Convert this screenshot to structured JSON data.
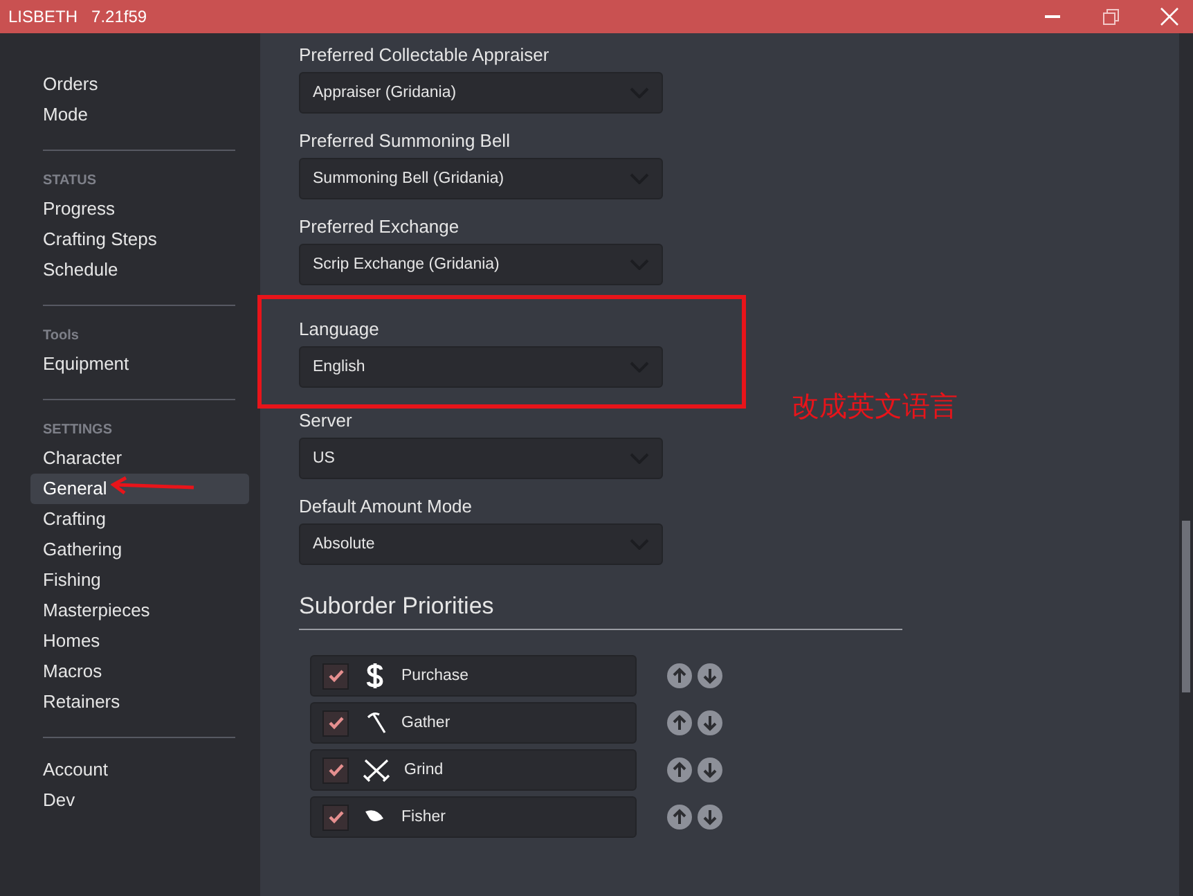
{
  "window": {
    "title": "LISBETH",
    "version": "7.21f59"
  },
  "sidebar": {
    "groups": [
      {
        "items": [
          {
            "label": "Orders",
            "selected": false
          },
          {
            "label": "Mode",
            "selected": false
          }
        ]
      },
      {
        "header": "STATUS",
        "items": [
          {
            "label": "Progress",
            "selected": false
          },
          {
            "label": "Crafting Steps",
            "selected": false
          },
          {
            "label": "Schedule",
            "selected": false
          }
        ]
      },
      {
        "header": "Tools",
        "items": [
          {
            "label": "Equipment",
            "selected": false
          }
        ]
      },
      {
        "header": "SETTINGS",
        "items": [
          {
            "label": "Character",
            "selected": false
          },
          {
            "label": "General",
            "selected": true
          },
          {
            "label": "Crafting",
            "selected": false
          },
          {
            "label": "Gathering",
            "selected": false
          },
          {
            "label": "Fishing",
            "selected": false
          },
          {
            "label": "Masterpieces",
            "selected": false
          },
          {
            "label": "Homes",
            "selected": false
          },
          {
            "label": "Macros",
            "selected": false
          },
          {
            "label": "Retainers",
            "selected": false
          }
        ]
      },
      {
        "items": [
          {
            "label": "Account",
            "selected": false
          },
          {
            "label": "Dev",
            "selected": false
          }
        ]
      }
    ]
  },
  "settings": [
    {
      "label": "Preferred Collectable Appraiser",
      "value": "Appraiser (Gridania)"
    },
    {
      "label": "Preferred Summoning Bell",
      "value": "Summoning Bell (Gridania)"
    },
    {
      "label": "Preferred Exchange",
      "value": "Scrip Exchange (Gridania)"
    },
    {
      "label": "Language",
      "value": "English",
      "highlighted": true
    },
    {
      "label": "Server",
      "value": "US"
    },
    {
      "label": "Default Amount Mode",
      "value": "Absolute"
    }
  ],
  "suborder_priorities": {
    "title": "Suborder Priorities",
    "items": [
      {
        "label": "Purchase",
        "kind": "purchase",
        "checked": true
      },
      {
        "label": "Gather",
        "kind": "gather",
        "checked": true
      },
      {
        "label": "Grind",
        "kind": "grind",
        "checked": true
      },
      {
        "label": "Fisher",
        "kind": "fisher",
        "checked": true
      }
    ]
  },
  "annotation": {
    "note": "改成英文语言"
  }
}
